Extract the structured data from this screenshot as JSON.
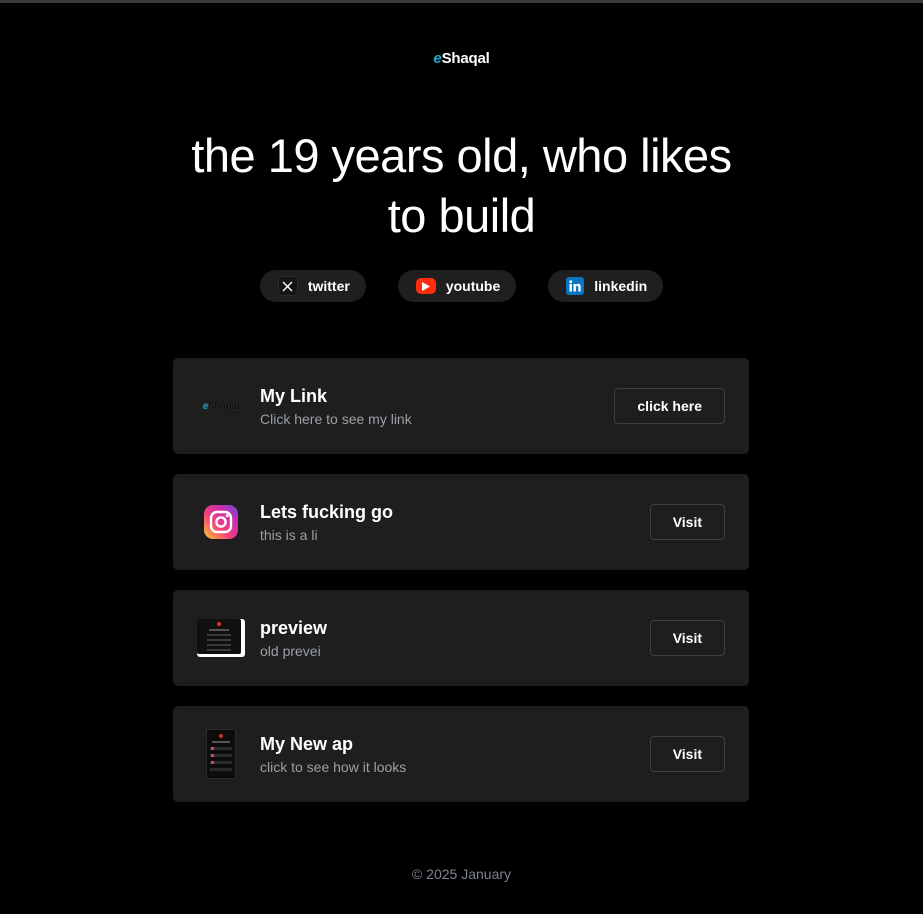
{
  "brand": {
    "logo_prefix": "e",
    "logo_text": "Shaqal"
  },
  "hero": {
    "line1": "the 19 years old, who likes",
    "line2": "to build"
  },
  "socials": [
    {
      "label": "twitter",
      "icon": "x-icon"
    },
    {
      "label": "youtube",
      "icon": "youtube-icon"
    },
    {
      "label": "linkedin",
      "icon": "linkedin-icon"
    }
  ],
  "cards": [
    {
      "title": "My Link",
      "subtitle": "Click here to see my link",
      "button": "click here",
      "thumb": "eshaqal-logo",
      "thumb_prefix": "e",
      "thumb_text": "Shaqal"
    },
    {
      "title": "Lets fucking go",
      "subtitle": "this is a li",
      "button": "Visit",
      "thumb": "instagram-icon"
    },
    {
      "title": "preview",
      "subtitle": "old prevei",
      "button": "Visit",
      "thumb": "preview-screenshot"
    },
    {
      "title": "My New ap",
      "subtitle": "click to see how it looks",
      "button": "Visit",
      "thumb": "app-screenshot"
    }
  ],
  "footer": {
    "text": "© 2025 January"
  },
  "colors": {
    "background": "#000000",
    "card": "#1e1e1e",
    "pill": "#1f1f1f",
    "brand_accent": "#22a8c9",
    "youtube": "#ff2d0b",
    "linkedin": "#0a76c2",
    "muted_text": "#9aa0a6"
  }
}
